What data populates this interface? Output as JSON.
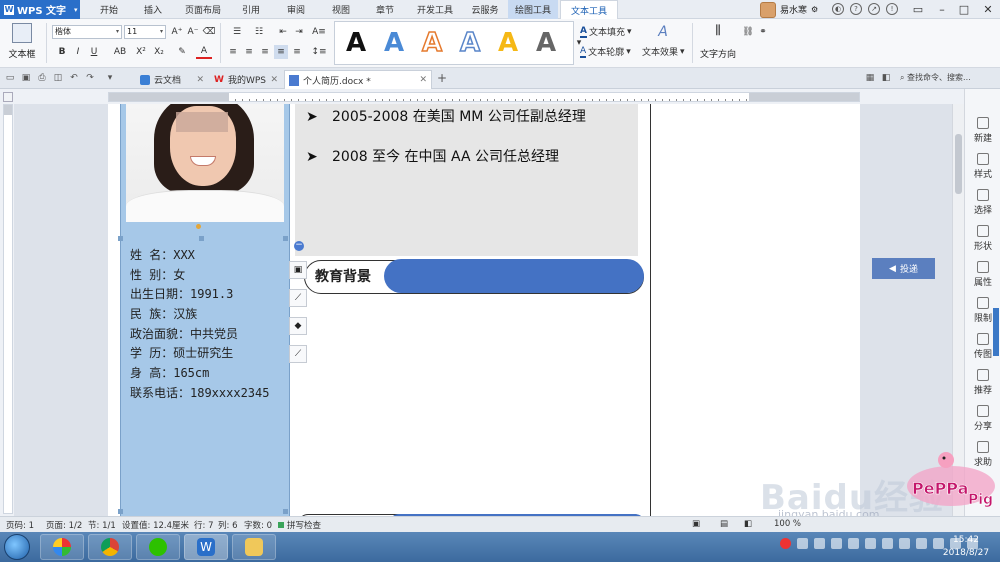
{
  "app": {
    "name": "WPS 文字",
    "user": "易水寒"
  },
  "menu": [
    "开始",
    "插入",
    "页面布局",
    "引用",
    "审阅",
    "视图",
    "章节",
    "开发工具",
    "云服务",
    "绘图工具",
    "文本工具"
  ],
  "ribbon": {
    "textbox": "文本框",
    "font": "楷体",
    "size": "11",
    "fill": "文本填充",
    "outline": "文本轮廓",
    "effect": "文本效果",
    "direction": "文字方向",
    "style_glyph": "A"
  },
  "tabs": {
    "cloud": "云文档",
    "mywps": "我的WPS",
    "doc": "个人简历.docx *",
    "add": "+",
    "search": "查找命令、搜索..."
  },
  "resume": {
    "info": [
      "姓    名：XXX",
      "性    别：女",
      "出生日期：1991.3",
      "民    族：汉族",
      "政治面貌：中共党员",
      "学    历：硕士研究生",
      "身    高：165cm",
      "联系电话：189xxxx2345"
    ],
    "experience": [
      "2005-2008 在美国 MM 公司任副总经理",
      "2008 至今 在中国 AA 公司任总经理"
    ],
    "bullet": "➤",
    "edu_title": "教育背景"
  },
  "toudi": "投递",
  "rpanel": [
    "新建",
    "样式",
    "选择",
    "形状",
    "属性",
    "限制",
    "传图",
    "推荐",
    "分享",
    "求助"
  ],
  "status": {
    "page": "页码: 1",
    "pages": "页面: 1/2",
    "section": "节: 1/1",
    "setting": "设置值: 12.4厘米",
    "row": "行: 7",
    "col": "列: 6",
    "chars": "字数: 0",
    "spell": "拼写检查",
    "zoom": "100 %"
  },
  "clock": {
    "time": "15:42",
    "date": "2018/8/27"
  },
  "watermark": {
    "main": "Baidu经验",
    "sub": "jingyan.baidu.com"
  },
  "colors": {
    "accent": "#4472c4",
    "sidebar": "#a6c8e8",
    "appblue": "#2a6fc9"
  }
}
